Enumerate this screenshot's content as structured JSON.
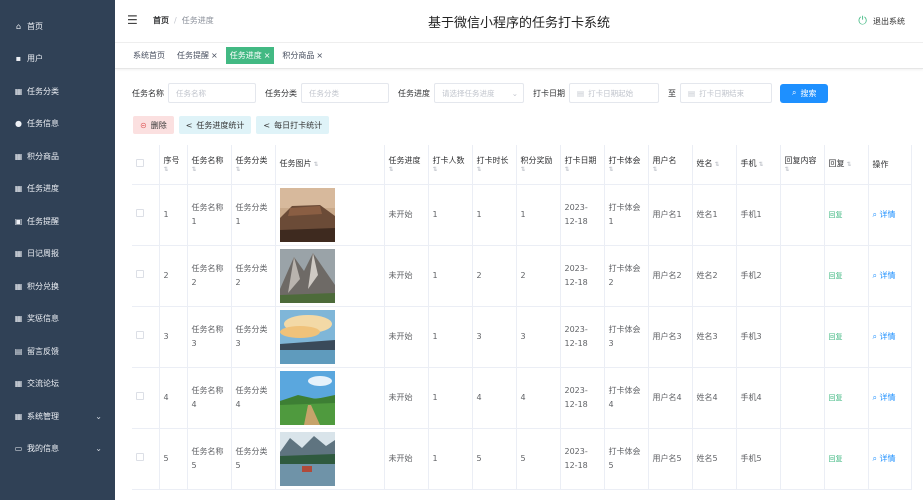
{
  "sidebar": {
    "items": [
      {
        "label": "首页",
        "icon": "home-icon",
        "glyph": "⌂"
      },
      {
        "label": "用户",
        "icon": "user-card-icon",
        "glyph": "▪"
      },
      {
        "label": "任务分类",
        "icon": "grid-icon",
        "glyph": "▦"
      },
      {
        "label": "任务信息",
        "icon": "person-icon",
        "glyph": "●"
      },
      {
        "label": "积分商品",
        "icon": "grid-icon",
        "glyph": "▦"
      },
      {
        "label": "任务进度",
        "icon": "grid-icon",
        "glyph": "▦"
      },
      {
        "label": "任务提醒",
        "icon": "briefcase-icon",
        "glyph": "▣"
      },
      {
        "label": "日记周报",
        "icon": "grid-icon",
        "glyph": "▦"
      },
      {
        "label": "积分兑换",
        "icon": "grid-icon",
        "glyph": "▦"
      },
      {
        "label": "奖惩信息",
        "icon": "grid-icon",
        "glyph": "▦"
      },
      {
        "label": "留言反馈",
        "icon": "message-icon",
        "glyph": "▤"
      },
      {
        "label": "交流论坛",
        "icon": "grid-icon",
        "glyph": "▦"
      },
      {
        "label": "系统管理",
        "icon": "grid-icon",
        "glyph": "▦",
        "expandable": true
      },
      {
        "label": "我的信息",
        "icon": "card-icon",
        "glyph": "▭",
        "expandable": true
      }
    ]
  },
  "header": {
    "breadcrumb_home": "首页",
    "breadcrumb_sep": "/",
    "breadcrumb_current": "任务进度",
    "title": "基于微信小程序的任务打卡系统",
    "logout_label": "退出系统"
  },
  "tabs": [
    {
      "label": "系统首页",
      "closable": false,
      "active": false
    },
    {
      "label": "任务提醒",
      "closable": true,
      "active": false
    },
    {
      "label": "任务进度",
      "closable": true,
      "active": true
    },
    {
      "label": "积分商品",
      "closable": true,
      "active": false
    }
  ],
  "search": {
    "task_name_label": "任务名称",
    "task_name_placeholder": "任务名称",
    "task_category_label": "任务分类",
    "task_category_placeholder": "任务分类",
    "progress_label": "任务进度",
    "progress_placeholder": "请选择任务进度",
    "date_label": "打卡日期",
    "date_start_placeholder": "打卡日期起始",
    "date_to": "至",
    "date_end_placeholder": "打卡日期结束",
    "search_button": "搜索"
  },
  "actions": {
    "delete": "删除",
    "progress_stats": "任务进度统计",
    "daily_stats": "每日打卡统计"
  },
  "table": {
    "columns": [
      "序号",
      "任务名称",
      "任务分类",
      "任务图片",
      "任务进度",
      "打卡人数",
      "打卡时长",
      "积分奖励",
      "打卡日期",
      "打卡体会",
      "用户名",
      "姓名",
      "手机",
      "回复内容",
      "回复",
      "操作"
    ],
    "reply_button": "回复",
    "detail_button": "详情",
    "rows": [
      {
        "index": "1",
        "task_name": "任务名称1",
        "category": "任务分类1",
        "progress": "未开始",
        "people": "1",
        "duration": "1",
        "points": "1",
        "date": "2023-12-18",
        "feeling": "打卡体会1",
        "username": "用户名1",
        "name": "姓名1",
        "phone": "手机1",
        "reply_content": ""
      },
      {
        "index": "2",
        "task_name": "任务名称2",
        "category": "任务分类2",
        "progress": "未开始",
        "people": "1",
        "duration": "2",
        "points": "2",
        "date": "2023-12-18",
        "feeling": "打卡体会2",
        "username": "用户名2",
        "name": "姓名2",
        "phone": "手机2",
        "reply_content": ""
      },
      {
        "index": "3",
        "task_name": "任务名称3",
        "category": "任务分类3",
        "progress": "未开始",
        "people": "1",
        "duration": "3",
        "points": "3",
        "date": "2023-12-18",
        "feeling": "打卡体会3",
        "username": "用户名3",
        "name": "姓名3",
        "phone": "手机3",
        "reply_content": ""
      },
      {
        "index": "4",
        "task_name": "任务名称4",
        "category": "任务分类4",
        "progress": "未开始",
        "people": "1",
        "duration": "4",
        "points": "4",
        "date": "2023-12-18",
        "feeling": "打卡体会4",
        "username": "用户名4",
        "name": "姓名4",
        "phone": "手机4",
        "reply_content": ""
      },
      {
        "index": "5",
        "task_name": "任务名称5",
        "category": "任务分类5",
        "progress": "未开始",
        "people": "1",
        "duration": "5",
        "points": "5",
        "date": "2023-12-18",
        "feeling": "打卡体会5",
        "username": "用户名5",
        "name": "姓名5",
        "phone": "手机5",
        "reply_content": ""
      }
    ]
  }
}
